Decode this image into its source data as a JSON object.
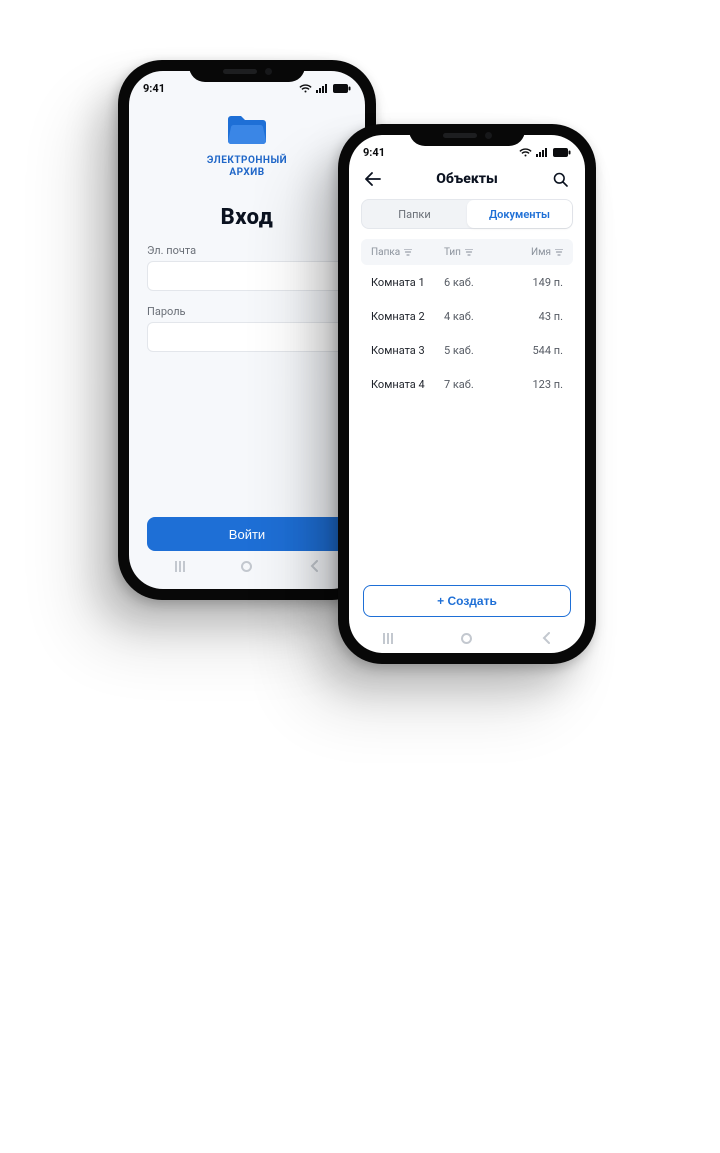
{
  "status": {
    "time": "9:41"
  },
  "login": {
    "logo_line1": "ЭЛЕКТРОННЫЙ",
    "logo_line2": "АРХИВ",
    "title": "Вход",
    "email_label": "Эл. почта",
    "password_label": "Пароль",
    "submit_label": "Войти"
  },
  "objects": {
    "title": "Объекты",
    "tabs": {
      "folders": "Папки",
      "documents": "Документы"
    },
    "columns": {
      "folder": "Папка",
      "type": "Тип",
      "name": "Имя"
    },
    "rows": [
      {
        "folder": "Комната 1",
        "type": "6 каб.",
        "name": "149 п."
      },
      {
        "folder": "Комната 2",
        "type": "4 каб.",
        "name": "43 п."
      },
      {
        "folder": "Комната 3",
        "type": "5 каб.",
        "name": "544 п."
      },
      {
        "folder": "Комната 4",
        "type": "7 каб.",
        "name": "123 п."
      }
    ],
    "create_label": "+ Создать"
  }
}
